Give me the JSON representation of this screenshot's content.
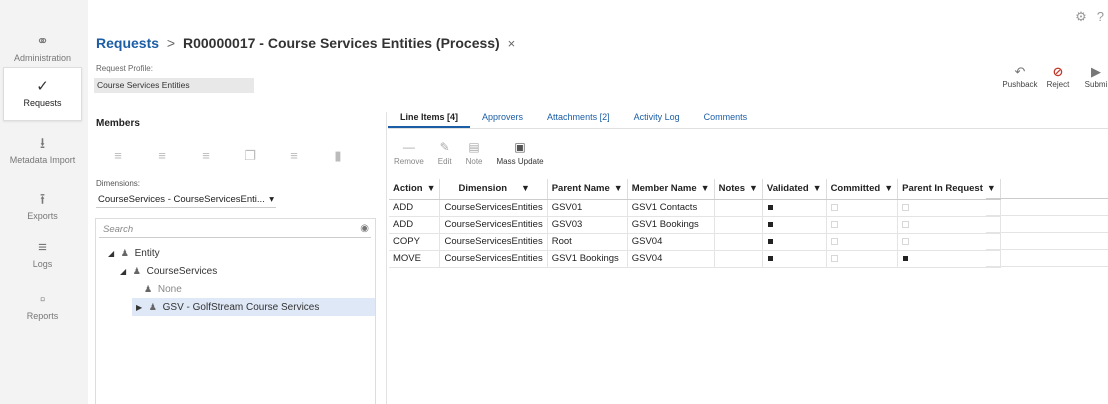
{
  "nav": {
    "items": [
      {
        "label": "Administration",
        "icon": "admin-icon"
      },
      {
        "label": "Requests",
        "icon": "requests-icon",
        "active": true
      },
      {
        "label": "Metadata Import",
        "icon": "download-icon"
      },
      {
        "label": "Exports",
        "icon": "upload-icon"
      },
      {
        "label": "Logs",
        "icon": "logs-icon"
      },
      {
        "label": "Reports",
        "icon": "clipboard-icon"
      }
    ]
  },
  "header": {
    "breadcrumb_root": "Requests",
    "separator": ">",
    "title": "R00000017  - Course Services Entities (Process)",
    "close": "×"
  },
  "profile": {
    "label": "Request Profile:",
    "value": "Course Services Entities"
  },
  "actions": {
    "pushback": "Pushback",
    "reject": "Reject",
    "submit": "Submi"
  },
  "members": {
    "heading": "Members",
    "dimensions_label": "Dimensions:",
    "dimension_value": "CourseServices - CourseServicesEnti...",
    "search_placeholder": "Search",
    "tree": {
      "entity": "Entity",
      "course_services": "CourseServices",
      "none": "None",
      "gsv": "GSV - GolfStream Course Services"
    }
  },
  "tabs": {
    "line_items": "Line Items [4]",
    "approvers": "Approvers",
    "attachments": "Attachments [2]",
    "activity": "Activity Log",
    "comments": "Comments"
  },
  "grid_tools": {
    "remove": "Remove",
    "edit": "Edit",
    "note": "Note",
    "mass_update": "Mass Update"
  },
  "grid": {
    "columns": [
      "Action",
      "Dimension",
      "Parent Name",
      "Member Name",
      "Notes",
      "Validated",
      "Committed",
      "Parent In Request"
    ],
    "rows": [
      {
        "action": "ADD",
        "dimension": "CourseServicesEntities",
        "parent": "GSV01",
        "member": "GSV1 Contacts",
        "notes": "",
        "validated": true,
        "committed": false,
        "parent_in_request": false
      },
      {
        "action": "ADD",
        "dimension": "CourseServicesEntities",
        "parent": "GSV03",
        "member": "GSV1 Bookings",
        "notes": "",
        "validated": true,
        "committed": false,
        "parent_in_request": false
      },
      {
        "action": "COPY",
        "dimension": "CourseServicesEntities",
        "parent": "Root",
        "member": "GSV04",
        "notes": "",
        "validated": true,
        "committed": false,
        "parent_in_request": false
      },
      {
        "action": "MOVE",
        "dimension": "CourseServicesEntities",
        "parent": "GSV1 Bookings",
        "member": "GSV04",
        "notes": "",
        "validated": true,
        "committed": false,
        "parent_in_request": true
      }
    ]
  }
}
